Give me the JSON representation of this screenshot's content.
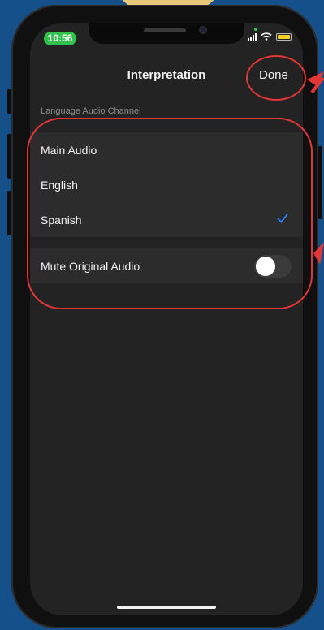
{
  "status_bar": {
    "time": "10:56"
  },
  "nav": {
    "title": "Interpretation",
    "done_label": "Done"
  },
  "section": {
    "header": "Language Audio Channel"
  },
  "channels": {
    "items": [
      {
        "label": "Main Audio",
        "selected": false
      },
      {
        "label": "English",
        "selected": false
      },
      {
        "label": "Spanish",
        "selected": true
      }
    ]
  },
  "mute": {
    "label": "Mute Original Audio",
    "enabled": false
  },
  "colors": {
    "accent_blue": "#2f80ff",
    "annotation_red": "#e53535",
    "time_pill_green": "#30c34c",
    "background": "#15508a"
  },
  "icons": {
    "check": "checkmark-icon",
    "wifi": "wifi-icon",
    "signal": "cellular-signal-icon",
    "battery": "battery-icon"
  }
}
